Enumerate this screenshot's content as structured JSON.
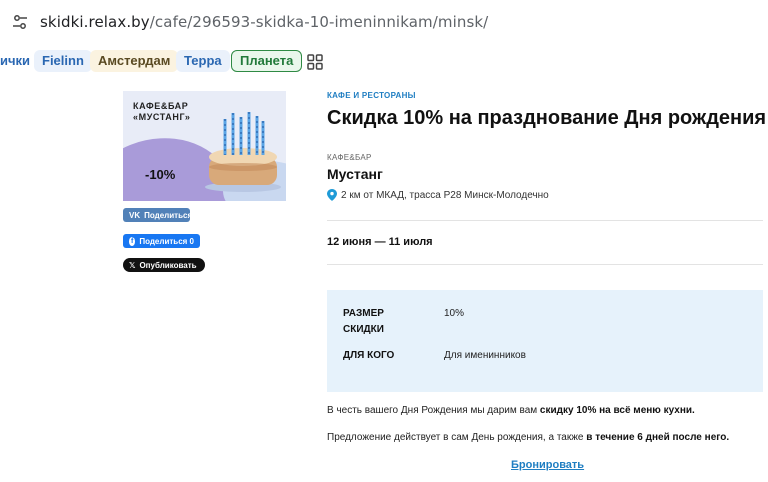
{
  "address_bar": {
    "host": "skidki.relax.by",
    "path": "/cafe/296593-skidka-10-imeninnikam/minsk/"
  },
  "tags": [
    "ички",
    "Fielinn",
    "Амстердам",
    "Терра",
    "Планета"
  ],
  "promo": {
    "title_line1": "КАФЕ&БАР",
    "title_line2": "«МУСТАНГ»",
    "discount": "-10%"
  },
  "share": {
    "vk": "Поделиться",
    "fb": "Поделиться 0",
    "x": "Опубликовать"
  },
  "offer": {
    "category": "КАФЕ И РЕСТОРАНЫ",
    "title": "Скидка 10% на празднование Дня рождения",
    "place_type": "КАФЕ&БАР",
    "place_name": "Мустанг",
    "location": "2 км от МКАД, трасса Р28 Минск-Молодечно",
    "dates": "12 июня — 11 июля"
  },
  "details": {
    "size_label_1": "РАЗМЕР",
    "size_label_2": "СКИДКИ",
    "size_value": "10%",
    "who_label": "ДЛЯ КОГО",
    "who_value": "Для именинников"
  },
  "description": {
    "p1_start": "В честь вашего Дня Рождения мы дарим вам ",
    "p1_bold": "скидку 10% на всё меню кухни.",
    "p2_start": "Предложение действует в сам День рождения, а также ",
    "p2_bold": "в течение 6 дней после него."
  },
  "book_link": "Бронировать",
  "colors": {
    "accent": "#1f7ec2",
    "info_bg": "#e6f2fb",
    "vk": "#5181b8",
    "fb": "#1877f2"
  },
  "icons": [
    "site-settings-icon",
    "grid-icon",
    "location-pin-icon",
    "vk-icon",
    "facebook-icon",
    "x-icon"
  ]
}
